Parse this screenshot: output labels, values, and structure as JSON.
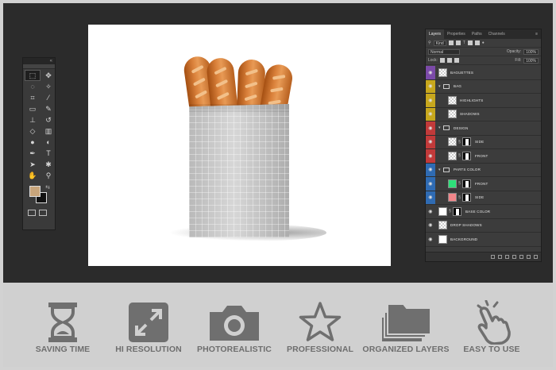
{
  "tools_panel": {
    "header_glyph": "«",
    "tools": [
      {
        "name": "rectangular-marquee-tool",
        "glyph": "⬚",
        "active": true
      },
      {
        "name": "move-tool",
        "glyph": "✥"
      },
      {
        "name": "lasso-tool",
        "glyph": "◌"
      },
      {
        "name": "magic-wand-tool",
        "glyph": "✧"
      },
      {
        "name": "crop-tool",
        "glyph": "⌗"
      },
      {
        "name": "eyedropper-tool",
        "glyph": "⁄"
      },
      {
        "name": "healing-brush-tool",
        "glyph": "▭"
      },
      {
        "name": "brush-tool",
        "glyph": "✎"
      },
      {
        "name": "clone-stamp-tool",
        "glyph": "⊥"
      },
      {
        "name": "history-brush-tool",
        "glyph": "↺"
      },
      {
        "name": "eraser-tool",
        "glyph": "◇"
      },
      {
        "name": "gradient-tool",
        "glyph": "▥"
      },
      {
        "name": "blur-tool",
        "glyph": "●"
      },
      {
        "name": "dodge-tool",
        "glyph": "◐"
      },
      {
        "name": "pen-tool",
        "glyph": "✒"
      },
      {
        "name": "type-tool",
        "glyph": "T"
      },
      {
        "name": "path-selection-tool",
        "glyph": "➤"
      },
      {
        "name": "custom-shape-tool",
        "glyph": "✱"
      },
      {
        "name": "hand-tool",
        "glyph": "✋"
      },
      {
        "name": "zoom-tool",
        "glyph": "⚲"
      }
    ],
    "foreground_color": "#c8a57b",
    "background_color": "#111111"
  },
  "layers_panel": {
    "tabs": [
      "Layers",
      "Properties",
      "Paths",
      "Channels"
    ],
    "active_tab": "Layers",
    "filter_label": "Kind",
    "blend_mode": "Normal",
    "opacity_label": "Opacity:",
    "opacity_value": "100%",
    "lock_label": "Lock:",
    "fill_label": "Fill:",
    "fill_value": "100%",
    "layers": [
      {
        "name": "BAGUETTES",
        "color": "#7b4aa8",
        "type": "image",
        "indent": 0
      },
      {
        "name": "BAG",
        "color": "#c7a71d",
        "type": "group",
        "indent": 0
      },
      {
        "name": "HIGHLIGHTS",
        "color": "#c7a71d",
        "type": "image",
        "indent": 1
      },
      {
        "name": "SHADOWS",
        "color": "#c7a71d",
        "type": "image",
        "indent": 1
      },
      {
        "name": "DESIGN",
        "color": "#c23a3a",
        "type": "group",
        "indent": 0
      },
      {
        "name": "SIDE",
        "color": "#c23a3a",
        "type": "smart-mask",
        "indent": 1
      },
      {
        "name": "FRONT",
        "color": "#c23a3a",
        "type": "smart-mask",
        "indent": 1
      },
      {
        "name": "PARTS COLOR",
        "color": "#2f6bb3",
        "type": "group",
        "indent": 0
      },
      {
        "name": "FRONT",
        "color": "#2f6bb3",
        "type": "fill-green",
        "indent": 1
      },
      {
        "name": "SIDE",
        "color": "#2f6bb3",
        "type": "fill-pink",
        "indent": 1
      },
      {
        "name": "BASE COLOR",
        "color": "",
        "type": "fill-white",
        "indent": 0
      },
      {
        "name": "DROP SHADOWS",
        "color": "",
        "type": "image",
        "indent": 0
      },
      {
        "name": "BACKGROUND",
        "color": "",
        "type": "fill-white-plain",
        "indent": 0
      }
    ]
  },
  "features": [
    {
      "name": "saving-time",
      "label": "SAVING TIME",
      "icon": "hourglass-icon"
    },
    {
      "name": "hi-resolution",
      "label": "HI RESOLUTION",
      "icon": "expand-icon"
    },
    {
      "name": "photorealistic",
      "label": "PHOTOREALISTIC",
      "icon": "camera-icon"
    },
    {
      "name": "professional",
      "label": "PROFESSIONAL",
      "icon": "star-icon"
    },
    {
      "name": "organized-layers",
      "label": "ORGANIZED LAYERS",
      "icon": "folders-icon"
    },
    {
      "name": "easy-to-use",
      "label": "EASY TO USE",
      "icon": "pointing-hand-icon"
    }
  ],
  "colors": {
    "workspace": "#2b2b2b",
    "feature_icon": "#6f6f6f",
    "feature_label": "#6e6e6e"
  }
}
